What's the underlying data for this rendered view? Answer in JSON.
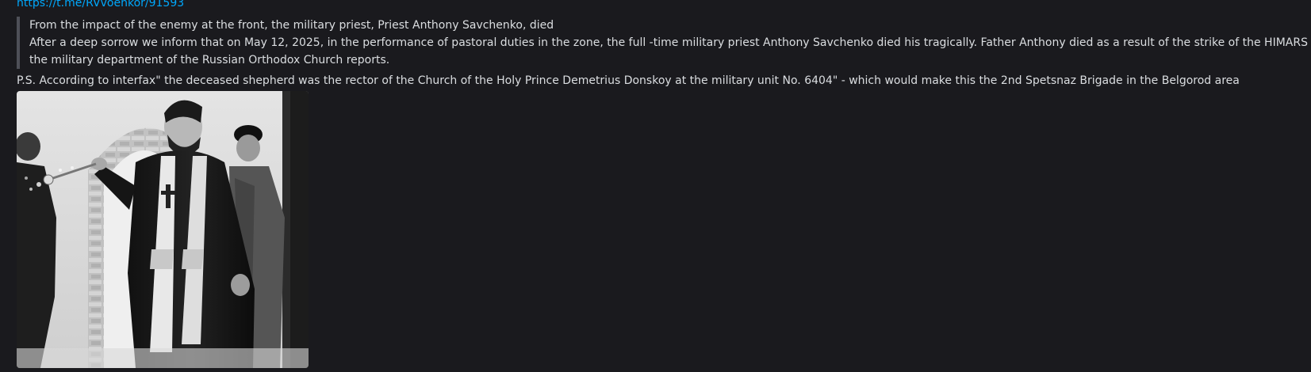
{
  "message": {
    "link_text": "https://t.me/RVvoenkor/91593",
    "quote_lines": [
      "From the impact of the enemy at the front, the military priest, Priest Anthony Savchenko, died",
      "After a deep sorrow we inform that on May 12, 2025, in the performance of pastoral duties in the zone, the full -time military priest Anthony Savchenko died his tragically. Father Anthony died as a result of the strike of the HIMARS RSO,",
      "the military department of the Russian Orthodox Church reports."
    ],
    "ps_text": "P.S. According to interfax\" the deceased shepherd was the rector of the Church of the Holy Prince Demetrius Donskoy at the military unit No. 6404\" - which would make this the 2nd Spetsnaz Brigade in the Belgorod area"
  },
  "attachment": {
    "type": "photo",
    "style": "black-and-white"
  },
  "colors": {
    "background": "#1a1a1e",
    "text": "#dbdee1",
    "link": "#00a8fc",
    "quote_bar": "#4e5058"
  }
}
